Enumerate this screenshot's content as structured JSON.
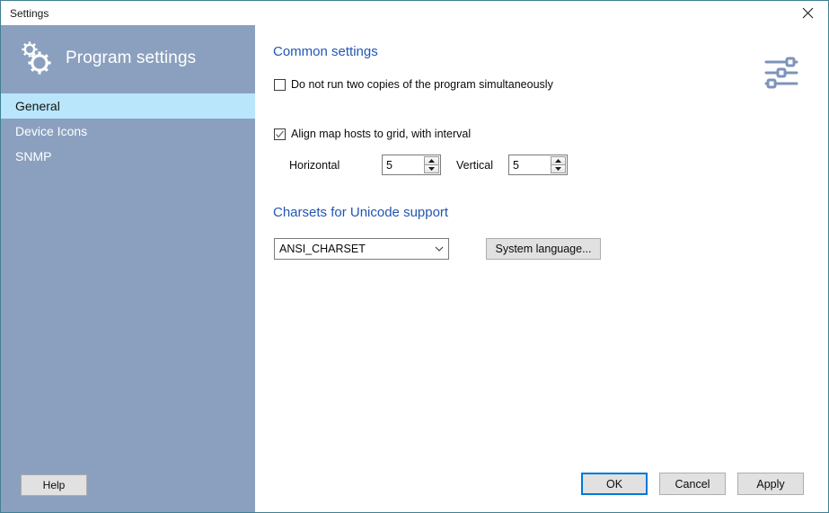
{
  "window": {
    "title": "Settings",
    "close_icon": "close-icon",
    "border_color": "#3f7f94"
  },
  "sidebar": {
    "title": "Program settings",
    "icon": "gears-icon",
    "background_color": "#8ba0bf",
    "selected_color": "#b9e6fb",
    "items": [
      {
        "label": "General",
        "selected": true
      },
      {
        "label": "Device Icons",
        "selected": false
      },
      {
        "label": "SNMP",
        "selected": false
      }
    ],
    "help_label": "Help"
  },
  "content": {
    "heading_color": "#2256b3",
    "sliders_icon": "sliders-icon",
    "common": {
      "heading": "Common settings",
      "single_instance": {
        "label": "Do not run two copies of the program simultaneously",
        "checked": false
      },
      "align_grid": {
        "label": "Align map hosts to grid, with interval",
        "checked": true
      },
      "horizontal": {
        "label": "Horizontal",
        "value": "5"
      },
      "vertical": {
        "label": "Vertical",
        "value": "5"
      }
    },
    "charsets": {
      "heading": "Charsets for Unicode support",
      "selected_charset": "ANSI_CHARSET",
      "system_language_label": "System language..."
    }
  },
  "footer": {
    "ok_label": "OK",
    "cancel_label": "Cancel",
    "apply_label": "Apply",
    "default_button_color": "#0078d7"
  }
}
